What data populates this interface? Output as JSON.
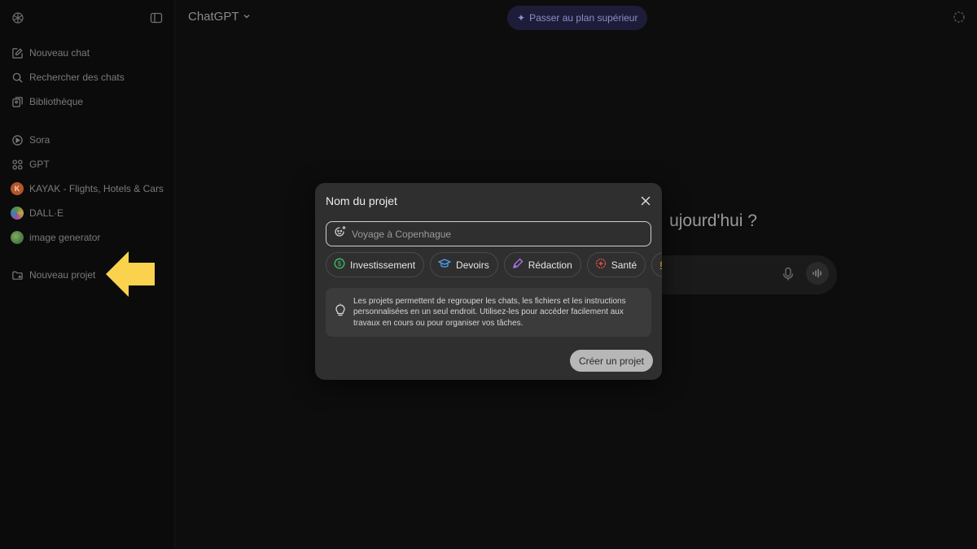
{
  "sidebar": {
    "items_top": [
      {
        "label": "Nouveau chat",
        "icon": "edit-icon"
      },
      {
        "label": "Rechercher des chats",
        "icon": "search-icon"
      },
      {
        "label": "Bibliothèque",
        "icon": "library-icon"
      }
    ],
    "items_apps": [
      {
        "label": "Sora",
        "icon": "play-circle-icon"
      },
      {
        "label": "GPT",
        "icon": "grid-icon"
      },
      {
        "label": "KAYAK - Flights, Hotels & Cars",
        "icon": "kayak-avatar"
      },
      {
        "label": "DALL·E",
        "icon": "dalle-avatar"
      },
      {
        "label": "image generator",
        "icon": "image-generator-avatar"
      }
    ],
    "items_projects": [
      {
        "label": "Nouveau projet",
        "icon": "folder-plus-icon"
      }
    ]
  },
  "header": {
    "model": "ChatGPT",
    "upgrade": "Passer au plan supérieur"
  },
  "main": {
    "greeting": "ujourd'hui ?"
  },
  "modal": {
    "title": "Nom du projet",
    "input_placeholder": "Voyage à Copenhague",
    "chips": [
      {
        "label": "Investissement",
        "icon": "dollar-icon",
        "color": "#3fbf6a"
      },
      {
        "label": "Devoirs",
        "icon": "graduation-cap-icon",
        "color": "#4a9ff5"
      },
      {
        "label": "Rédaction",
        "icon": "pen-icon",
        "color": "#b277f0"
      },
      {
        "label": "Santé",
        "icon": "health-icon",
        "color": "#e8574a"
      }
    ],
    "info": "Les projets permettent de regrouper les chats, les fichiers et les instructions personnalisées en un seul endroit. Utilisez-les pour accéder facilement aux travaux en cours ou pour organiser vos tâches.",
    "create_button": "Créer un projet"
  },
  "colors": {
    "arrow": "#fbd24e",
    "upgrade_bg": "#1d1d3a"
  }
}
